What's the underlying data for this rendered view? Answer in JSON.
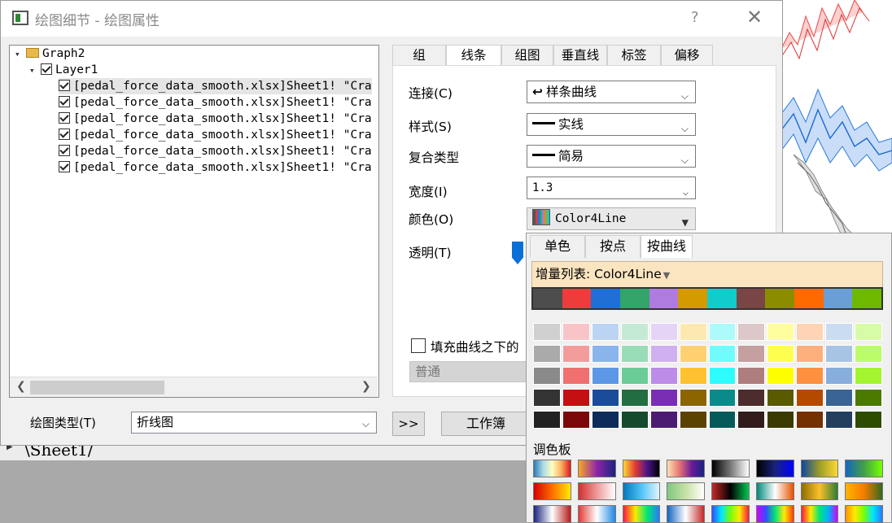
{
  "window": {
    "title": "绘图细节 - 绘图属性",
    "help": "?",
    "close": "✕"
  },
  "tree": {
    "graph": "Graph2",
    "layer": "Layer1",
    "items": [
      "[pedal_force_data_smooth.xlsx]Sheet1! \"Cra",
      "[pedal_force_data_smooth.xlsx]Sheet1! \"Cra",
      "[pedal_force_data_smooth.xlsx]Sheet1! \"Cra",
      "[pedal_force_data_smooth.xlsx]Sheet1! \"Cra",
      "[pedal_force_data_smooth.xlsx]Sheet1! \"Cra",
      "[pedal_force_data_smooth.xlsx]Sheet1! \"Cra"
    ]
  },
  "bottom": {
    "plot_type_label": "绘图类型(T)",
    "plot_type_value": "折线图",
    "expand_label": ">>",
    "workbook_label": "工作簿"
  },
  "tabs": [
    "组",
    "线条",
    "组图",
    "垂直线",
    "标签",
    "偏移"
  ],
  "active_tab": "线条",
  "form": {
    "connect_label": "连接(C)",
    "connect_value": "样条曲线",
    "style_label": "样式(S)",
    "style_value": "实线",
    "compound_label": "复合类型",
    "compound_value": "简易",
    "width_label": "宽度(I)",
    "width_value": "1.3",
    "color_label": "颜色(O)",
    "color_value": "Color4Line",
    "transparency_label": "透明(T)",
    "fill_label": "填充曲线之下的",
    "normal_value": "普通"
  },
  "popup": {
    "tabs": [
      "单色",
      "按点",
      "按曲线"
    ],
    "active_tab": "按曲线",
    "increment_label": "增量列表: Color4Line",
    "palette_label": "调色板",
    "increment_colors": [
      "#4d4d4d",
      "#ee3b3b",
      "#1f6fd6",
      "#32a46a",
      "#b07be0",
      "#d49a00",
      "#12cccc",
      "#7a4545",
      "#8c8c00",
      "#ff6a00",
      "#6a9fd6",
      "#6fb800"
    ],
    "shade_rows": [
      [
        "#d0d0d0",
        "#f8c4c8",
        "#bcd4f4",
        "#c4ead6",
        "#e6d4f6",
        "#fde8b0",
        "#aefafa",
        "#dcc8c8",
        "#fefe9e",
        "#fed4b4",
        "#cadcf0",
        "#d6fca8"
      ],
      [
        "#aaaaaa",
        "#f49c9c",
        "#8ab4ec",
        "#98dcb8",
        "#d0b0f0",
        "#fed070",
        "#6efcfc",
        "#c4a0a0",
        "#fefe50",
        "#feb07c",
        "#a8c4e4",
        "#bafc6a"
      ],
      [
        "#8a8a8a",
        "#f07070",
        "#5c98e6",
        "#6ccc98",
        "#bc8ce8",
        "#fec230",
        "#2efcfc",
        "#ae7e7e",
        "#fefe00",
        "#fe9040",
        "#88aede",
        "#a4f430"
      ],
      [
        "#333333",
        "#c41010",
        "#1a4c9a",
        "#226e42",
        "#7a2eb4",
        "#8c6400",
        "#0a8a8a",
        "#4c2c2c",
        "#5a5a00",
        "#b44a00",
        "#3a6494",
        "#4a7a00"
      ],
      [
        "#222222",
        "#7a0808",
        "#0e2c5a",
        "#164a2c",
        "#4c1c72",
        "#5c4200",
        "#065a5a",
        "#321c1c",
        "#3a3a00",
        "#743000",
        "#243e5e",
        "#2e4c00"
      ]
    ],
    "gradients": [
      [
        "linear-gradient(90deg,#2c7bb6,#abd9e9,#ffffbf,#fdae61,#d7191c)",
        "linear-gradient(90deg,#f9a825,#8e24aa,#1a237e)",
        "linear-gradient(90deg,#fdd835,#e53935,#4a148c,#000)",
        "linear-gradient(90deg,#ffe0b2,#e57373,#6a1b9a,#1a237e)",
        "linear-gradient(90deg,#000,#777,#fff)",
        "linear-gradient(90deg,#000,#1a237e,#0000ff)",
        "linear-gradient(90deg,#0d47a1,#9e9d24,#fdd835)",
        "linear-gradient(90deg,#1565c0,#43a047,#76ff03)"
      ],
      [
        "linear-gradient(90deg,#d50000,#ff6d00,#ffea00)",
        "linear-gradient(90deg,#d32f2f,#ef9a9a,#fff)",
        "linear-gradient(90deg,#0277bd,#4fc3f7,#e1f5fe)",
        "linear-gradient(90deg,#81c784,#c5e1a5,#fff)",
        "linear-gradient(90deg,#c62828,#000,#00c853)",
        "linear-gradient(90deg,#00897b,#fff,#e65100)",
        "linear-gradient(90deg,#8d6e00,#fbc02d,#2e7d32)",
        "linear-gradient(90deg,#ffb300,#f57c00,#33691e)"
      ],
      [
        "linear-gradient(90deg,#1a237e,#fff,#b71c1c)",
        "linear-gradient(90deg,#e53935,#fff,#1e88e5)",
        "linear-gradient(90deg,#ff1744,#ffea00,#00e676,#2979ff)",
        "linear-gradient(90deg,#1565c0,#fff,#c62828)",
        "linear-gradient(90deg,#304ffe,#00e5ff,#76ff03,#ffea00,#ff1744)",
        "linear-gradient(90deg,#d500f9,#304ffe,#00e676,#ffea00,#ff3d00)",
        "linear-gradient(90deg,#ff1744,#ffea00,#00e676,#00b0ff,#d500f9)",
        "linear-gradient(90deg,#ff9100,#ffea00,#76ff03,#00e5ff,#2979ff)"
      ]
    ]
  },
  "sheet": {
    "tab_label": "\\Sheet1/"
  }
}
